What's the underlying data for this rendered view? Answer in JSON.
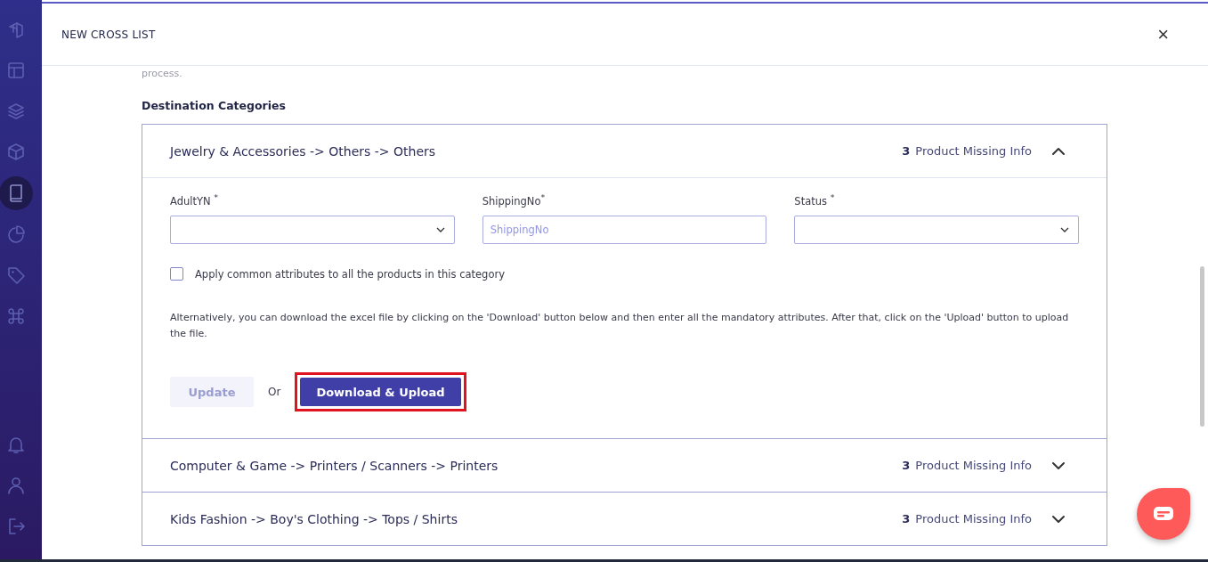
{
  "sidebar": {
    "items": [
      {
        "kind": "logo",
        "selected": false
      },
      {
        "kind": "layout",
        "selected": false
      },
      {
        "kind": "layers",
        "selected": false
      },
      {
        "kind": "box",
        "selected": false
      },
      {
        "kind": "book",
        "selected": true
      },
      {
        "kind": "pie",
        "selected": false
      },
      {
        "kind": "tag",
        "selected": false
      },
      {
        "kind": "command",
        "selected": false
      }
    ],
    "bottom_items": [
      {
        "kind": "bell",
        "selected": false
      },
      {
        "kind": "user",
        "selected": false
      },
      {
        "kind": "logout",
        "selected": false
      }
    ]
  },
  "modal": {
    "title": "NEW CROSS LIST",
    "close": "×",
    "intro_tail": "process.",
    "section_title": "Destination Categories",
    "categories": [
      {
        "title": "Jewelry & Accessories -> Others -> Others",
        "count": "3",
        "count_label": "Product Missing Info",
        "expanded": true,
        "fields": [
          {
            "kind": "select",
            "label": "AdultYN $^{*}$"
          },
          {
            "kind": "text",
            "label": "ShippingNo$^{*}$",
            "placeholder": "ShippingNo"
          },
          {
            "kind": "select",
            "label": "Status $^{*}$"
          }
        ],
        "apply_common": {
          "label": "Apply common attributes to all the products in this category",
          "checked": false
        },
        "note": "Alternatively, you can download the excel file by clicking on the 'Download' button below and then enter all the mandatory attributes. After that, click on the 'Upload' button to upload the file.",
        "update_button": {
          "label": "Update",
          "disabled": true
        },
        "or_text": "Or",
        "download_button": {
          "label": "Download & Upload",
          "highlighted": true
        }
      },
      {
        "title": "Computer & Game -> Printers / Scanners -> Printers",
        "count": "3",
        "count_label": "Product Missing Info",
        "expanded": false
      },
      {
        "title": "Kids Fashion -> Boy's Clothing -> Tops / Shirts",
        "count": "3",
        "count_label": "Product Missing Info",
        "expanded": false
      }
    ]
  }
}
